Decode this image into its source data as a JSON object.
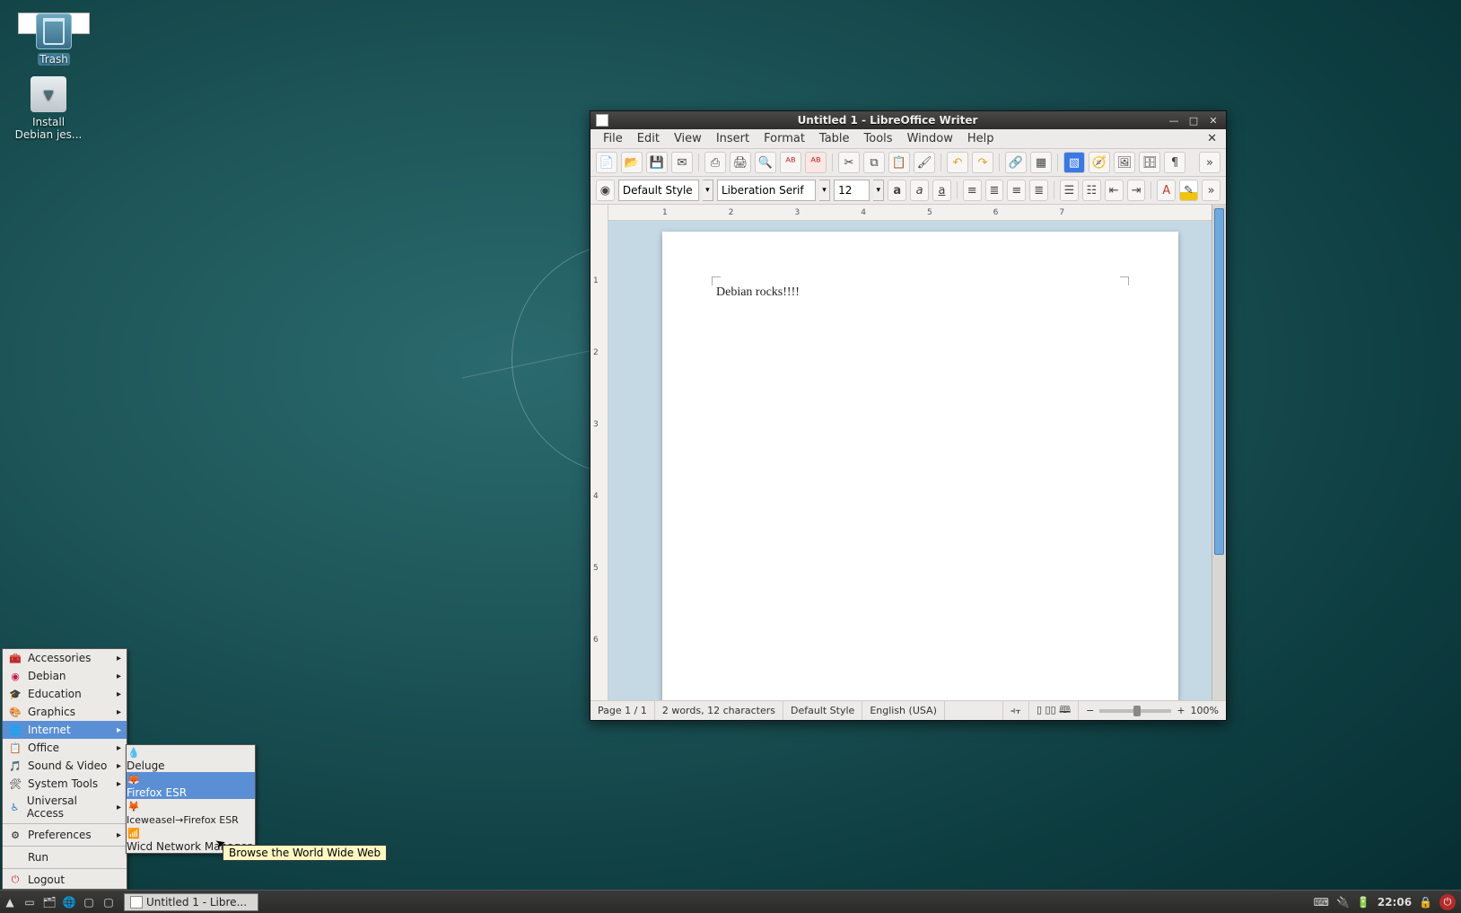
{
  "desktop": {
    "icons": [
      {
        "name": "trash",
        "label": "Trash"
      },
      {
        "name": "install-debian",
        "label": "Install\nDebian jes..."
      }
    ]
  },
  "app_menu": {
    "categories": [
      {
        "label": "Accessories",
        "has_sub": true
      },
      {
        "label": "Debian",
        "has_sub": true
      },
      {
        "label": "Education",
        "has_sub": true
      },
      {
        "label": "Graphics",
        "has_sub": true
      },
      {
        "label": "Internet",
        "has_sub": true,
        "active": true
      },
      {
        "label": "Office",
        "has_sub": true
      },
      {
        "label": "Sound & Video",
        "has_sub": true
      },
      {
        "label": "System Tools",
        "has_sub": true
      },
      {
        "label": "Universal Access",
        "has_sub": true
      }
    ],
    "preferences_label": "Preferences",
    "run_label": "Run",
    "logout_label": "Logout",
    "submenu_internet": [
      {
        "label": "Deluge"
      },
      {
        "label": "Firefox ESR",
        "active": true
      },
      {
        "label": "Iceweasel→Firefox ESR"
      },
      {
        "label": "Wicd Network Manager"
      }
    ],
    "tooltip": "Browse the World Wide Web"
  },
  "taskbar": {
    "task_label": "Untitled 1 - Libre...",
    "clock": "22:06"
  },
  "writer": {
    "title": "Untitled 1 - LibreOffice Writer",
    "menus": [
      "File",
      "Edit",
      "View",
      "Insert",
      "Format",
      "Table",
      "Tools",
      "Window",
      "Help"
    ],
    "style_value": "Default Style",
    "font_value": "Liberation Serif",
    "size_value": "12",
    "document_text": "Debian rocks!!!!",
    "ruler_marks": [
      "1",
      "2",
      "3",
      "4",
      "5",
      "6",
      "7"
    ],
    "vruler_marks": [
      "1",
      "2",
      "3",
      "4",
      "5",
      "6"
    ],
    "status": {
      "page": "Page 1 / 1",
      "words": "2 words, 12 characters",
      "style": "Default Style",
      "lang": "English (USA)",
      "zoom": "100%"
    }
  }
}
